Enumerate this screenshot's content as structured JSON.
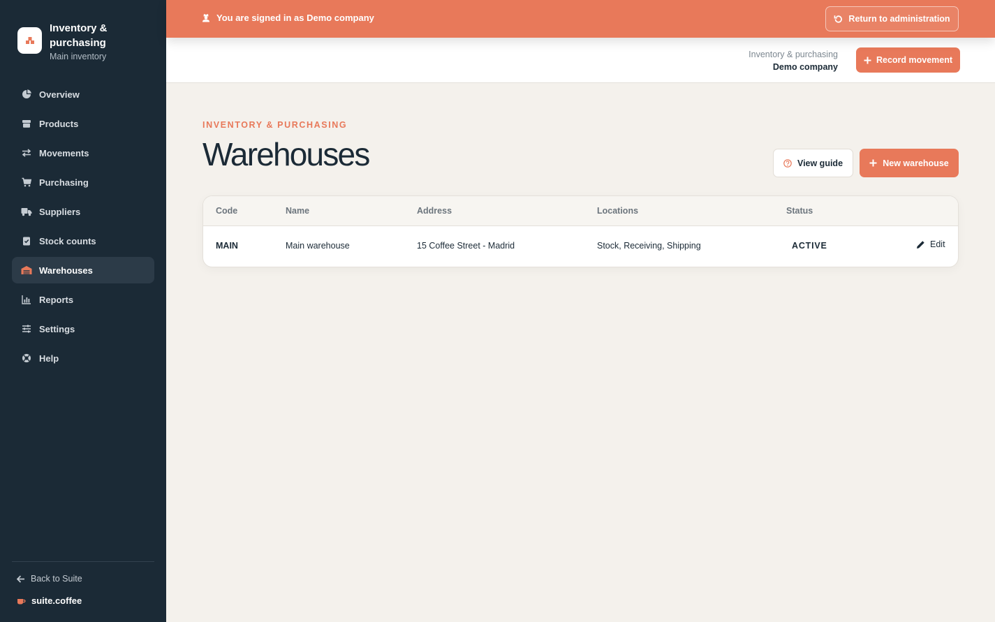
{
  "brand": {
    "title": "Inventory & purchasing",
    "subtitle": "Main inventory"
  },
  "nav": [
    {
      "label": "Overview",
      "icon": "pie-chart-icon"
    },
    {
      "label": "Products",
      "icon": "box-icon"
    },
    {
      "label": "Movements",
      "icon": "swap-arrows-icon"
    },
    {
      "label": "Purchasing",
      "icon": "cart-icon"
    },
    {
      "label": "Suppliers",
      "icon": "truck-icon"
    },
    {
      "label": "Stock counts",
      "icon": "clipboard-check-icon"
    },
    {
      "label": "Warehouses",
      "icon": "warehouse-icon",
      "active": true
    },
    {
      "label": "Reports",
      "icon": "bar-chart-icon"
    },
    {
      "label": "Settings",
      "icon": "sliders-icon"
    },
    {
      "label": "Help",
      "icon": "lifebuoy-icon"
    }
  ],
  "sidebar_footer": {
    "back_label": "Back to Suite",
    "suite_label": "suite.coffee"
  },
  "banner": {
    "message": "You are signed in as Demo company",
    "return_label": "Return to administration"
  },
  "header": {
    "app_name": "Inventory & purchasing",
    "company": "Demo company",
    "record_label": "Record movement"
  },
  "page": {
    "eyebrow": "INVENTORY & PURCHASING",
    "title": "Warehouses",
    "guide_label": "View guide",
    "new_label": "New warehouse"
  },
  "table": {
    "columns": [
      "Code",
      "Name",
      "Address",
      "Locations",
      "Status"
    ],
    "rows": [
      {
        "code": "MAIN",
        "name": "Main warehouse",
        "address": "15 Coffee Street - Madrid",
        "locations": "Stock, Receiving, Shipping",
        "status": "ACTIVE",
        "edit_label": "Edit"
      }
    ]
  },
  "colors": {
    "accent": "#e8795a",
    "sidebar": "#1b2a36",
    "background": "#f4f1ec"
  }
}
